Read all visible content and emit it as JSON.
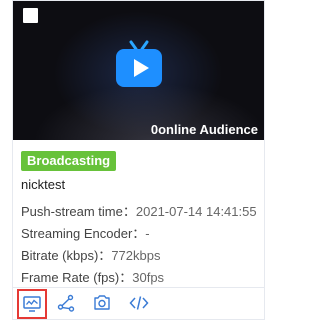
{
  "stream_card": {
    "thumbnail_overlay": "0online Audience",
    "status_badge": "Broadcasting",
    "stream_name": "nicktest",
    "details": [
      {
        "label": "Push-stream time：",
        "value": "2021-07-14 14:41:55"
      },
      {
        "label": "Streaming Encoder：",
        "value": "-"
      },
      {
        "label": "Bitrate (kbps)：",
        "value": "772kbps"
      },
      {
        "label": "Frame Rate (fps)：",
        "value": "30fps"
      }
    ],
    "actions": [
      {
        "icon": "monitor-icon",
        "highlighted": true
      },
      {
        "icon": "share-icon"
      },
      {
        "icon": "screenshot-icon"
      },
      {
        "icon": "code-icon"
      }
    ]
  },
  "colors": {
    "accent": "#3a7bd5",
    "badge_green": "#67c23a",
    "highlight_red": "#e53935",
    "thumbnail_bg": "#0d0d12"
  }
}
